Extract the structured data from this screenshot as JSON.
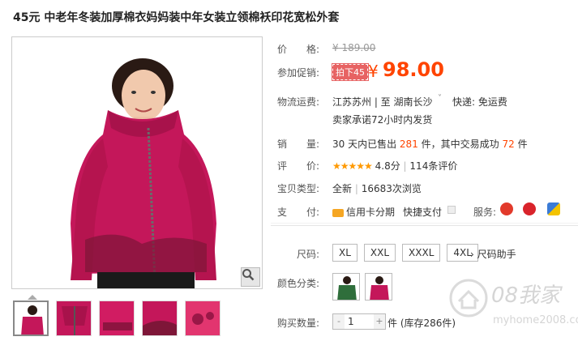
{
  "title": "45元 中老年冬装加厚棉衣妈妈装中年女装立领棉袄印花宽松外套",
  "price": {
    "label": "价　　格:",
    "original": "¥ 189.00"
  },
  "promo": {
    "label": "参加促销:",
    "badge": "拍下45",
    "symbol": "¥",
    "value": "98.00"
  },
  "shipping": {
    "label": "物流运费:",
    "route": "江苏苏州 | 至  湖南长沙",
    "dropdown": "˅",
    "fee": "快递: 免运费",
    "promise": "卖家承诺72小时内发货"
  },
  "sales": {
    "label": "销　　量:",
    "prefix": "30 天内已售出",
    "sold": "281",
    "mid": "件，其中交易成功",
    "success": "72",
    "suffix": "件"
  },
  "rating": {
    "label": "评　　价:",
    "stars": "★★★★★",
    "score": "4.8分",
    "sep": "|",
    "reviews": "114条评价"
  },
  "type": {
    "label": "宝贝类型:",
    "condition": "全新",
    "sep": "|",
    "views": "16683次浏览"
  },
  "payment": {
    "label": "支　　付:",
    "credit": "信用卡分期",
    "quick": "快捷支付",
    "service_label": "服务:"
  },
  "size": {
    "label": "尺码:",
    "options": [
      "XL",
      "XXL",
      "XXXL",
      "4XL"
    ],
    "help": "› 尺码助手"
  },
  "color": {
    "label": "颜色分类:"
  },
  "quantity": {
    "label": "购买数量:",
    "minus": "-",
    "value": "1",
    "plus": "+",
    "stock": "件 (库存286件)"
  },
  "watermark": {
    "brand": "08我家",
    "url": "myhome2008.com"
  },
  "colors": {
    "accent": "#ff4400",
    "jacket": "#c4175a",
    "badge": "#e76363"
  }
}
